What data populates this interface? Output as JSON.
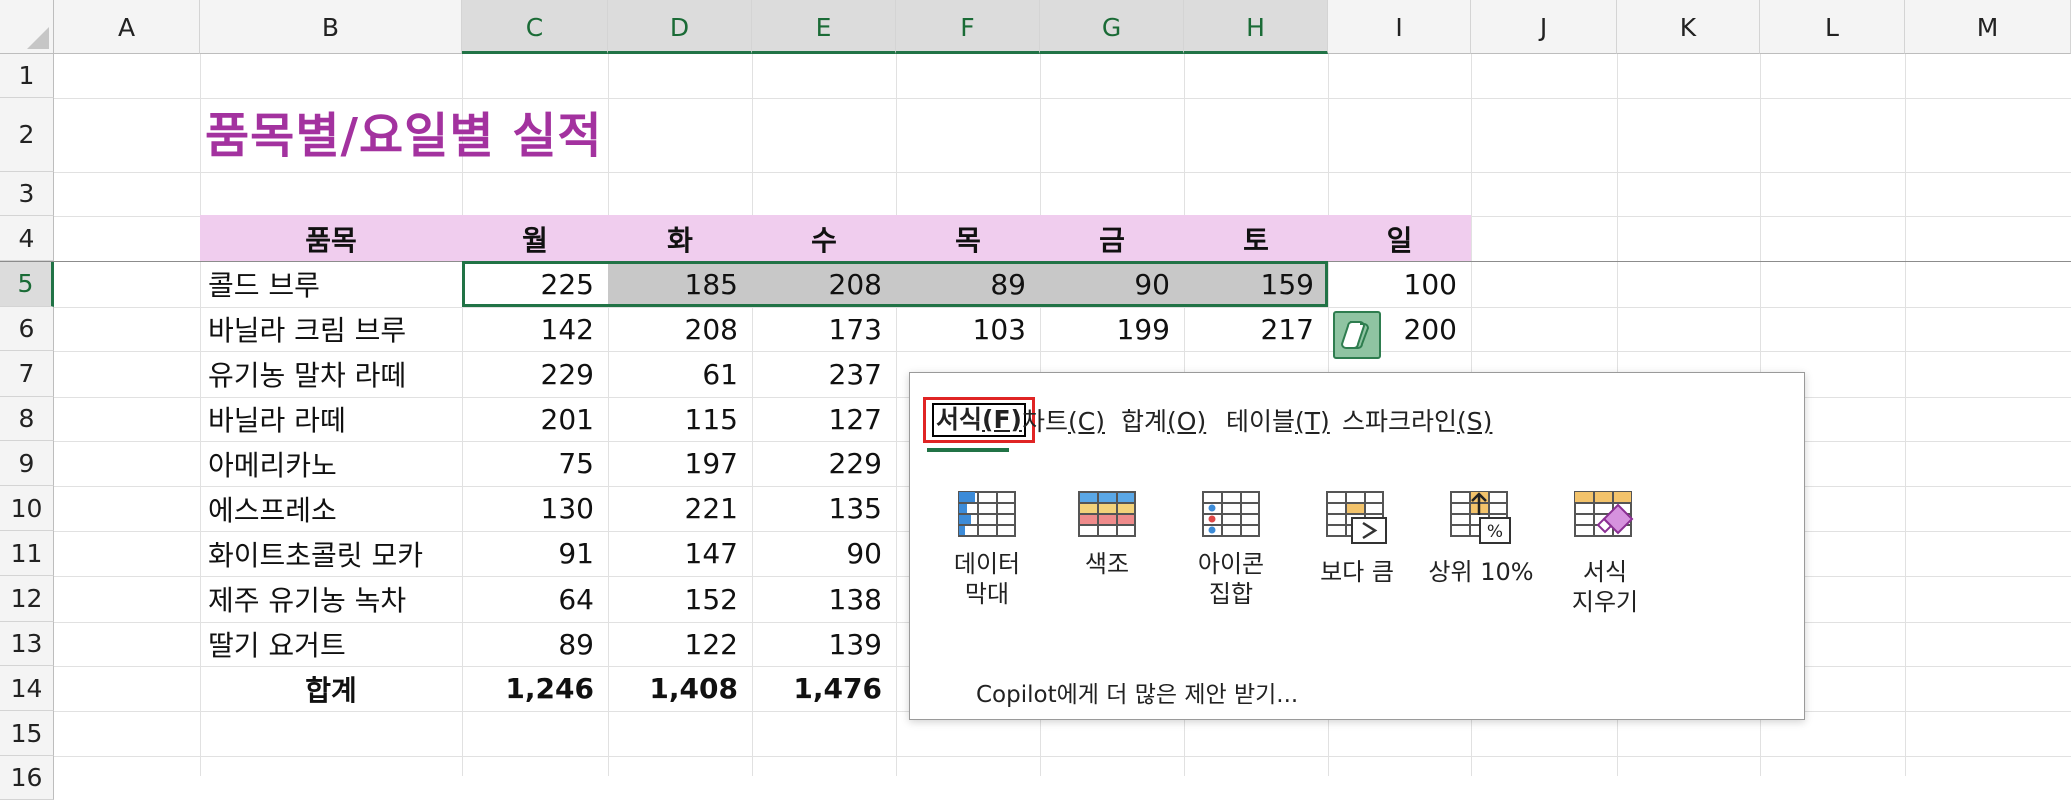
{
  "columns": [
    "A",
    "B",
    "C",
    "D",
    "E",
    "F",
    "G",
    "H",
    "I",
    "J",
    "K",
    "L",
    "M"
  ],
  "rows": [
    "1",
    "2",
    "3",
    "4",
    "5",
    "6",
    "7",
    "8",
    "9",
    "10",
    "11",
    "12",
    "13",
    "14",
    "15",
    "16"
  ],
  "title": "품목별/요일별 실적",
  "table_header": [
    "품목",
    "월",
    "화",
    "수",
    "목",
    "금",
    "토",
    "일"
  ],
  "table_rows": [
    {
      "name": "콜드 브루",
      "values": [
        "225",
        "185",
        "208",
        "89",
        "90",
        "159",
        "100"
      ]
    },
    {
      "name": "바닐라 크림 브루",
      "values": [
        "142",
        "208",
        "173",
        "103",
        "199",
        "217",
        "200"
      ]
    },
    {
      "name": "유기농 말차 라떼",
      "values": [
        "229",
        "61",
        "237",
        "",
        "",
        "",
        ""
      ]
    },
    {
      "name": "바닐라 라떼",
      "values": [
        "201",
        "115",
        "127",
        "",
        "",
        "",
        ""
      ]
    },
    {
      "name": "아메리카노",
      "values": [
        "75",
        "197",
        "229",
        "",
        "",
        "",
        ""
      ]
    },
    {
      "name": "에스프레소",
      "values": [
        "130",
        "221",
        "135",
        "",
        "",
        "",
        ""
      ]
    },
    {
      "name": "화이트초콜릿 모카",
      "values": [
        "91",
        "147",
        "90",
        "",
        "",
        "",
        ""
      ]
    },
    {
      "name": "제주 유기농 녹차",
      "values": [
        "64",
        "152",
        "138",
        "",
        "",
        "",
        ""
      ]
    },
    {
      "name": "딸기 요거트",
      "values": [
        "89",
        "122",
        "139",
        "",
        "",
        "",
        ""
      ]
    }
  ],
  "total_row": {
    "name": "합계",
    "values": [
      "1,246",
      "1,408",
      "1,476"
    ]
  },
  "quick_analysis": {
    "tabs": [
      {
        "label": "서식",
        "key": "(F)"
      },
      {
        "label": "차트",
        "key": "(C)"
      },
      {
        "label": "합계",
        "key": "(O)"
      },
      {
        "label": "테이블",
        "key": "(T)"
      },
      {
        "label": "스파크라인",
        "key": "(S)"
      }
    ],
    "items": [
      {
        "label": "데이터\n막대",
        "icon": "data-bars-icon"
      },
      {
        "label": "색조",
        "icon": "color-scale-icon"
      },
      {
        "label": "아이콘\n집합",
        "icon": "icon-set-icon"
      },
      {
        "label": "보다 큼",
        "icon": "greater-than-icon"
      },
      {
        "label": "상위 10%",
        "icon": "top-10-percent-icon"
      },
      {
        "label": "서식\n지우기",
        "icon": "clear-format-icon"
      }
    ],
    "more_link": "Copilot에게 더 많은 제안 받기..."
  },
  "colors": {
    "title": "#a3329f",
    "header_band": "#f0cdee",
    "selection": "#217346"
  }
}
